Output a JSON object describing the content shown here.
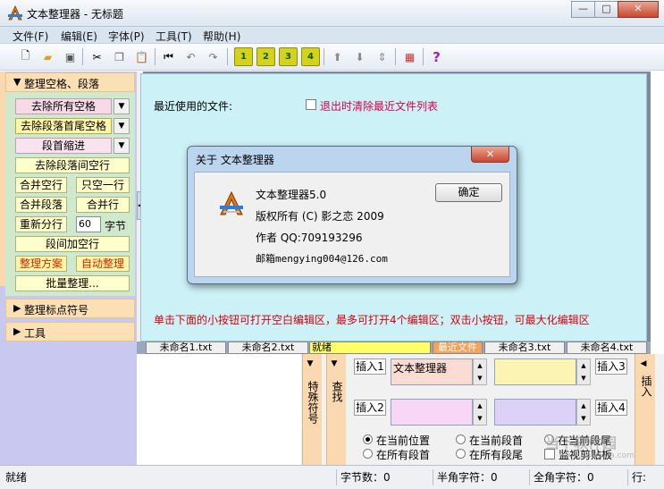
{
  "window": {
    "title": "文本整理器 - 无标题"
  },
  "menu": [
    "文件(F)",
    "编辑(E)",
    "字体(P)",
    "工具(T)",
    "帮助(H)"
  ],
  "toolbar": {
    "nums": [
      "1",
      "2",
      "3",
      "4"
    ],
    "help": "?"
  },
  "left": {
    "sec1": "整理空格、段落",
    "btn_remove_all_spaces": "去除所有空格",
    "btn_remove_head_tail": "去除段落首尾空格",
    "btn_indent": "段首缩进",
    "btn_remove_blank_lines": "去除段落间空行",
    "btn_merge_blank": "合并空行",
    "btn_keep_one": "只空一行",
    "btn_merge_para": "合并段落",
    "btn_merge_lines": "合并行",
    "btn_resplit": "重新分行",
    "resplit_value": "60",
    "resplit_unit": "字节",
    "btn_add_blank": "段间加空行",
    "btn_scheme": "整理方案",
    "btn_auto": "自动整理",
    "btn_batch": "批量整理...",
    "sec2": "整理标点符号",
    "sec3": "工具"
  },
  "main": {
    "recent_label": "最近使用的文件:",
    "clear_recent": "退出时清除最近文件列表",
    "hint": "单击下面的小按钮可打开空白编辑区，最多可打开4个编辑区；双击小按钮，可最大化编辑区"
  },
  "doc_tabs": [
    "未命名1.txt",
    "未命名2.txt",
    "就绪",
    "最近文件",
    "未命名3.txt",
    "未命名4.txt"
  ],
  "bottom": {
    "special_symbols": "特殊符号",
    "find": "查找",
    "insert1": "插入1",
    "insert2": "插入2",
    "insert3": "插入3",
    "insert4": "插入4",
    "insert_side": "插入",
    "text1": "文本整理器",
    "radio": [
      "在当前位置",
      "在当前段首",
      "在当前段尾",
      "在所有段首",
      "在所有段尾"
    ],
    "monitor": "监视剪贴板"
  },
  "status": {
    "ready": "就绪",
    "bytes": "字节数：0",
    "half": "半角字符：0",
    "full": "全角字符：0",
    "row": "行:"
  },
  "dialog": {
    "title": "关于 文本整理器",
    "line1": "文本整理器5.0",
    "line2": "版权所有 (C) 影之恋 2009",
    "line3": "作者 QQ:709193296",
    "line4": "邮箱mengying004@126.com",
    "ok": "确定"
  },
  "watermark": {
    "main": "当下软件园",
    "url": "www.downxia.com"
  }
}
